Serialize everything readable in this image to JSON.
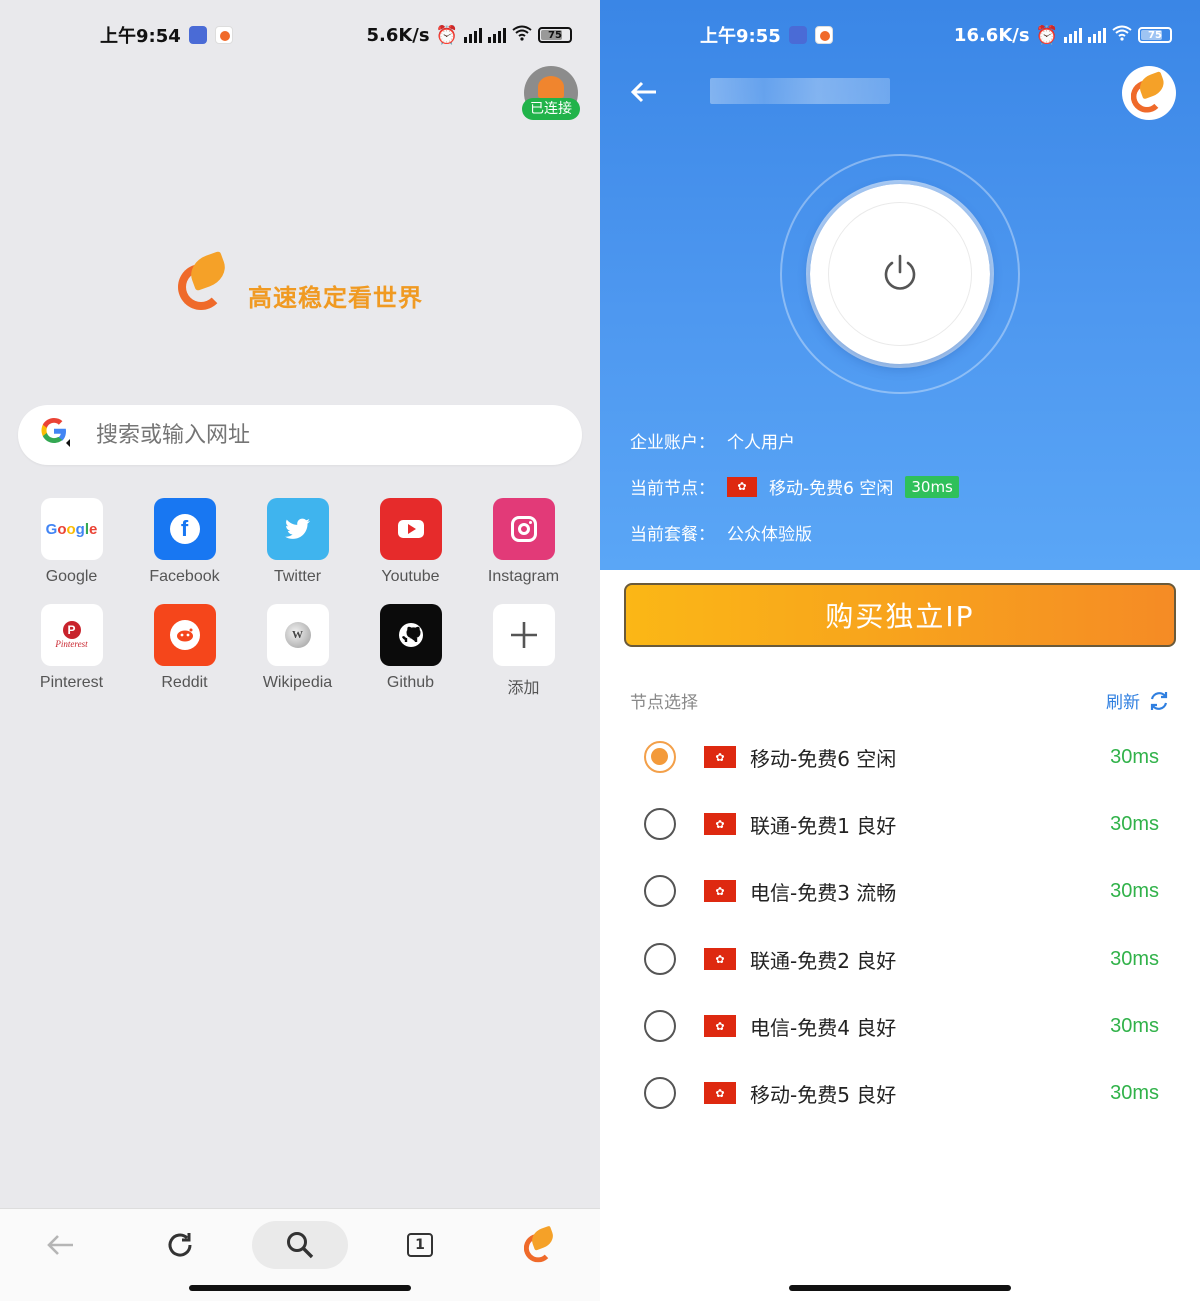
{
  "left": {
    "status": {
      "time": "上午9:54",
      "speed": "5.6K/s",
      "battery": "75"
    },
    "connected_label": "已连接",
    "brand_text": "高速稳定看世界",
    "search": {
      "placeholder": "搜索或输入网址"
    },
    "tiles": [
      {
        "label": "Google",
        "icon": "google-icon",
        "color": "#ffffff"
      },
      {
        "label": "Facebook",
        "icon": "facebook-icon",
        "color": "#1877f2"
      },
      {
        "label": "Twitter",
        "icon": "twitter-icon",
        "color": "#3fb4ee"
      },
      {
        "label": "Youtube",
        "icon": "youtube-icon",
        "color": "#e62b2b"
      },
      {
        "label": "Instagram",
        "icon": "instagram-icon",
        "color": "#e23a78"
      },
      {
        "label": "Pinterest",
        "icon": "pinterest-icon",
        "color": "#ffffff"
      },
      {
        "label": "Reddit",
        "icon": "reddit-icon",
        "color": "#f5461b"
      },
      {
        "label": "Wikipedia",
        "icon": "wikipedia-icon",
        "color": "#ffffff"
      },
      {
        "label": "Github",
        "icon": "github-icon",
        "color": "#0b0b0b"
      },
      {
        "label": "添加",
        "icon": "plus-icon",
        "color": "#ffffff"
      }
    ],
    "tab_count": "1"
  },
  "right": {
    "status": {
      "time": "上午9:55",
      "speed": "16.6K/s",
      "battery": "75"
    },
    "account": {
      "label": "企业账户：",
      "value": "个人用户"
    },
    "current_node": {
      "label": "当前节点：",
      "value": "移动-免费6 空闲",
      "latency": "30ms"
    },
    "plan": {
      "label": "当前套餐：",
      "value": "公众体验版"
    },
    "buy_button": "购买独立IP",
    "node_section": {
      "title": "节点选择",
      "refresh": "刷新"
    },
    "nodes": [
      {
        "name": "移动-免费6 空闲",
        "latency": "30ms",
        "selected": true
      },
      {
        "name": "联通-免费1 良好",
        "latency": "30ms",
        "selected": false
      },
      {
        "name": "电信-免费3 流畅",
        "latency": "30ms",
        "selected": false
      },
      {
        "name": "联通-免费2 良好",
        "latency": "30ms",
        "selected": false
      },
      {
        "name": "电信-免费4 良好",
        "latency": "30ms",
        "selected": false
      },
      {
        "name": "移动-免费5 良好",
        "latency": "30ms",
        "selected": false
      }
    ]
  }
}
